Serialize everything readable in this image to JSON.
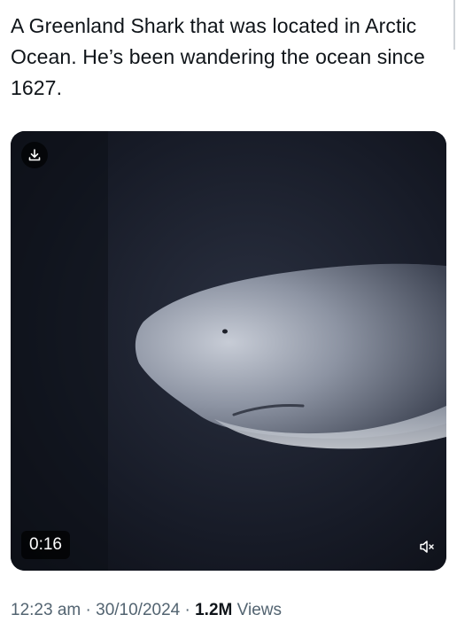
{
  "tweet": {
    "text": "A Greenland Shark that was located in Arctic Ocean. He’s been wandering the ocean since 1627."
  },
  "media": {
    "duration": "0:16",
    "download_icon": "download-icon",
    "mute_icon": "speaker-muted-icon"
  },
  "meta": {
    "time": "12:23 am",
    "separator": "·",
    "date": "30/10/2024",
    "views_count": "1.2M",
    "views_label": "Views"
  },
  "colors": {
    "text": "#0f1419",
    "secondary": "#536471",
    "video_bg": "#121520"
  }
}
